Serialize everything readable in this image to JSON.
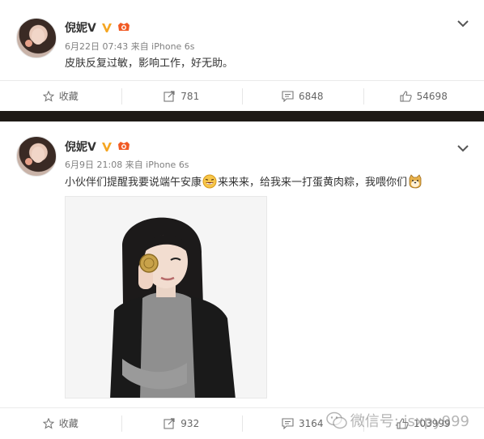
{
  "posts": [
    {
      "username": "倪妮V",
      "meta": "6月22日 07:43 来自 iPhone 6s",
      "text": "皮肤反复过敏，影响工作，好无助。",
      "actions": {
        "favorite": "收藏",
        "repost": "781",
        "comment": "6848",
        "like": "54698"
      }
    },
    {
      "username": "倪妮V",
      "meta": "6月9日 21:08 来自 iPhone 6s",
      "text_part1": "小伙伴们提醒我要说端午安康",
      "text_part2": "来来来，给我来一打蛋黄肉粽，我喂你们",
      "actions": {
        "favorite": "收藏",
        "repost": "932",
        "comment": "3164",
        "like": "103999"
      }
    }
  ],
  "watermark": "微信号: jsxpy999",
  "icons": {
    "verified": "verified-v-icon",
    "vip": "vip-badge-icon",
    "menu": "chevron-down-icon",
    "favorite": "star-icon",
    "repost": "repost-arrow-icon",
    "comment": "comment-bubble-icon",
    "like": "thumbs-up-icon"
  },
  "colors": {
    "verified": "#f5a623",
    "vip": "#f15a24",
    "divider": "#1e1a16",
    "meta": "#808080"
  }
}
